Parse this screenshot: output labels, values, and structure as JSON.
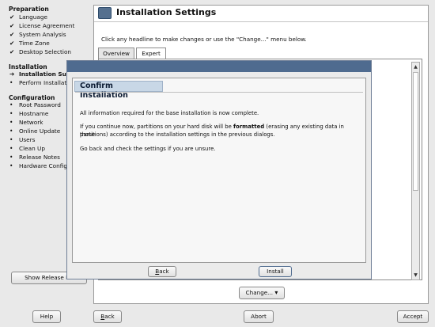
{
  "sidebar": {
    "sections": [
      {
        "title": "Preparation",
        "items": [
          {
            "mark": "✔",
            "label": "Language"
          },
          {
            "mark": "✔",
            "label": "License Agreement"
          },
          {
            "mark": "✔",
            "label": "System Analysis"
          },
          {
            "mark": "✔",
            "label": "Time Zone"
          },
          {
            "mark": "✔",
            "label": "Desktop Selection"
          }
        ]
      },
      {
        "title": "Installation",
        "items": [
          {
            "mark": "➔",
            "label": "Installation Summ"
          },
          {
            "mark": "•",
            "label": "Perform Installati"
          }
        ]
      },
      {
        "title": "Configuration",
        "items": [
          {
            "mark": "•",
            "label": "Root Password"
          },
          {
            "mark": "•",
            "label": "Hostname"
          },
          {
            "mark": "•",
            "label": "Network"
          },
          {
            "mark": "•",
            "label": "Online Update"
          },
          {
            "mark": "•",
            "label": "Users"
          },
          {
            "mark": "•",
            "label": "Clean Up"
          },
          {
            "mark": "•",
            "label": "Release Notes"
          },
          {
            "mark": "•",
            "label": "Hardware Configu"
          }
        ]
      }
    ],
    "show_release_notes_label": "Show Release No"
  },
  "main": {
    "title": "Installation Settings",
    "instruction": "Click any headline to make changes or use the \"Change...\" menu below.",
    "tabs": [
      {
        "label": "Overview",
        "active": false
      },
      {
        "label": "Expert",
        "active": true
      }
    ],
    "change_button_label": "Change...",
    "change_arrow": "▾"
  },
  "dialog": {
    "heading": "Confirm Installation",
    "line1": "All information required for the base installation is now complete.",
    "line2_before": "If you continue now, partitions on your hard disk will be ",
    "line2_bold": "formatted",
    "line2_after": " (erasing any existing data in those",
    "line3": "partitions) according to the installation settings in the previous dialogs.",
    "line4": "Go back and check the settings if you are unsure.",
    "back_label": "Back",
    "install_label": "Install"
  },
  "footer": {
    "help_label": "Help",
    "back_label": "Back",
    "abort_label": "Abort",
    "accept_label": "Accept"
  },
  "colors": {
    "titlebar": "#4f6b8f",
    "heading_bg": "#c8d7e6"
  }
}
